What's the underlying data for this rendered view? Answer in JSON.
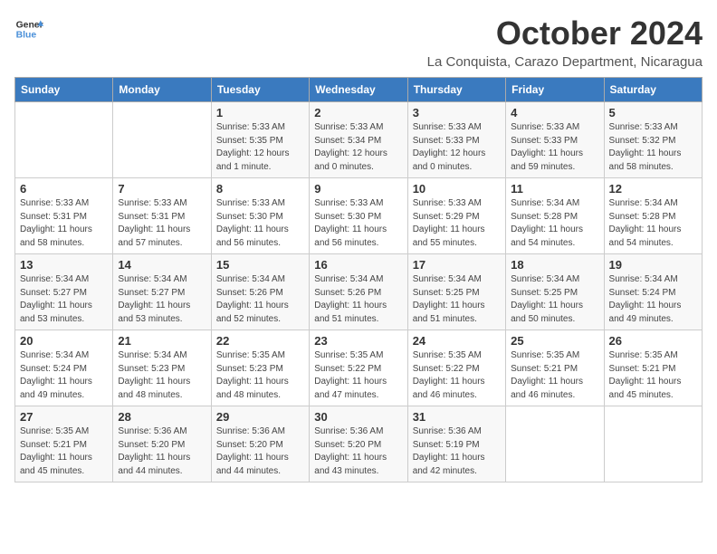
{
  "logo": {
    "line1": "General",
    "line2": "Blue"
  },
  "title": "October 2024",
  "location": "La Conquista, Carazo Department, Nicaragua",
  "weekdays": [
    "Sunday",
    "Monday",
    "Tuesday",
    "Wednesday",
    "Thursday",
    "Friday",
    "Saturday"
  ],
  "weeks": [
    [
      {
        "day": "",
        "sunrise": "",
        "sunset": "",
        "daylight": ""
      },
      {
        "day": "",
        "sunrise": "",
        "sunset": "",
        "daylight": ""
      },
      {
        "day": "1",
        "sunrise": "Sunrise: 5:33 AM",
        "sunset": "Sunset: 5:35 PM",
        "daylight": "Daylight: 12 hours and 1 minute."
      },
      {
        "day": "2",
        "sunrise": "Sunrise: 5:33 AM",
        "sunset": "Sunset: 5:34 PM",
        "daylight": "Daylight: 12 hours and 0 minutes."
      },
      {
        "day": "3",
        "sunrise": "Sunrise: 5:33 AM",
        "sunset": "Sunset: 5:33 PM",
        "daylight": "Daylight: 12 hours and 0 minutes."
      },
      {
        "day": "4",
        "sunrise": "Sunrise: 5:33 AM",
        "sunset": "Sunset: 5:33 PM",
        "daylight": "Daylight: 11 hours and 59 minutes."
      },
      {
        "day": "5",
        "sunrise": "Sunrise: 5:33 AM",
        "sunset": "Sunset: 5:32 PM",
        "daylight": "Daylight: 11 hours and 58 minutes."
      }
    ],
    [
      {
        "day": "6",
        "sunrise": "Sunrise: 5:33 AM",
        "sunset": "Sunset: 5:31 PM",
        "daylight": "Daylight: 11 hours and 58 minutes."
      },
      {
        "day": "7",
        "sunrise": "Sunrise: 5:33 AM",
        "sunset": "Sunset: 5:31 PM",
        "daylight": "Daylight: 11 hours and 57 minutes."
      },
      {
        "day": "8",
        "sunrise": "Sunrise: 5:33 AM",
        "sunset": "Sunset: 5:30 PM",
        "daylight": "Daylight: 11 hours and 56 minutes."
      },
      {
        "day": "9",
        "sunrise": "Sunrise: 5:33 AM",
        "sunset": "Sunset: 5:30 PM",
        "daylight": "Daylight: 11 hours and 56 minutes."
      },
      {
        "day": "10",
        "sunrise": "Sunrise: 5:33 AM",
        "sunset": "Sunset: 5:29 PM",
        "daylight": "Daylight: 11 hours and 55 minutes."
      },
      {
        "day": "11",
        "sunrise": "Sunrise: 5:34 AM",
        "sunset": "Sunset: 5:28 PM",
        "daylight": "Daylight: 11 hours and 54 minutes."
      },
      {
        "day": "12",
        "sunrise": "Sunrise: 5:34 AM",
        "sunset": "Sunset: 5:28 PM",
        "daylight": "Daylight: 11 hours and 54 minutes."
      }
    ],
    [
      {
        "day": "13",
        "sunrise": "Sunrise: 5:34 AM",
        "sunset": "Sunset: 5:27 PM",
        "daylight": "Daylight: 11 hours and 53 minutes."
      },
      {
        "day": "14",
        "sunrise": "Sunrise: 5:34 AM",
        "sunset": "Sunset: 5:27 PM",
        "daylight": "Daylight: 11 hours and 53 minutes."
      },
      {
        "day": "15",
        "sunrise": "Sunrise: 5:34 AM",
        "sunset": "Sunset: 5:26 PM",
        "daylight": "Daylight: 11 hours and 52 minutes."
      },
      {
        "day": "16",
        "sunrise": "Sunrise: 5:34 AM",
        "sunset": "Sunset: 5:26 PM",
        "daylight": "Daylight: 11 hours and 51 minutes."
      },
      {
        "day": "17",
        "sunrise": "Sunrise: 5:34 AM",
        "sunset": "Sunset: 5:25 PM",
        "daylight": "Daylight: 11 hours and 51 minutes."
      },
      {
        "day": "18",
        "sunrise": "Sunrise: 5:34 AM",
        "sunset": "Sunset: 5:25 PM",
        "daylight": "Daylight: 11 hours and 50 minutes."
      },
      {
        "day": "19",
        "sunrise": "Sunrise: 5:34 AM",
        "sunset": "Sunset: 5:24 PM",
        "daylight": "Daylight: 11 hours and 49 minutes."
      }
    ],
    [
      {
        "day": "20",
        "sunrise": "Sunrise: 5:34 AM",
        "sunset": "Sunset: 5:24 PM",
        "daylight": "Daylight: 11 hours and 49 minutes."
      },
      {
        "day": "21",
        "sunrise": "Sunrise: 5:34 AM",
        "sunset": "Sunset: 5:23 PM",
        "daylight": "Daylight: 11 hours and 48 minutes."
      },
      {
        "day": "22",
        "sunrise": "Sunrise: 5:35 AM",
        "sunset": "Sunset: 5:23 PM",
        "daylight": "Daylight: 11 hours and 48 minutes."
      },
      {
        "day": "23",
        "sunrise": "Sunrise: 5:35 AM",
        "sunset": "Sunset: 5:22 PM",
        "daylight": "Daylight: 11 hours and 47 minutes."
      },
      {
        "day": "24",
        "sunrise": "Sunrise: 5:35 AM",
        "sunset": "Sunset: 5:22 PM",
        "daylight": "Daylight: 11 hours and 46 minutes."
      },
      {
        "day": "25",
        "sunrise": "Sunrise: 5:35 AM",
        "sunset": "Sunset: 5:21 PM",
        "daylight": "Daylight: 11 hours and 46 minutes."
      },
      {
        "day": "26",
        "sunrise": "Sunrise: 5:35 AM",
        "sunset": "Sunset: 5:21 PM",
        "daylight": "Daylight: 11 hours and 45 minutes."
      }
    ],
    [
      {
        "day": "27",
        "sunrise": "Sunrise: 5:35 AM",
        "sunset": "Sunset: 5:21 PM",
        "daylight": "Daylight: 11 hours and 45 minutes."
      },
      {
        "day": "28",
        "sunrise": "Sunrise: 5:36 AM",
        "sunset": "Sunset: 5:20 PM",
        "daylight": "Daylight: 11 hours and 44 minutes."
      },
      {
        "day": "29",
        "sunrise": "Sunrise: 5:36 AM",
        "sunset": "Sunset: 5:20 PM",
        "daylight": "Daylight: 11 hours and 44 minutes."
      },
      {
        "day": "30",
        "sunrise": "Sunrise: 5:36 AM",
        "sunset": "Sunset: 5:20 PM",
        "daylight": "Daylight: 11 hours and 43 minutes."
      },
      {
        "day": "31",
        "sunrise": "Sunrise: 5:36 AM",
        "sunset": "Sunset: 5:19 PM",
        "daylight": "Daylight: 11 hours and 42 minutes."
      },
      {
        "day": "",
        "sunrise": "",
        "sunset": "",
        "daylight": ""
      },
      {
        "day": "",
        "sunrise": "",
        "sunset": "",
        "daylight": ""
      }
    ]
  ]
}
